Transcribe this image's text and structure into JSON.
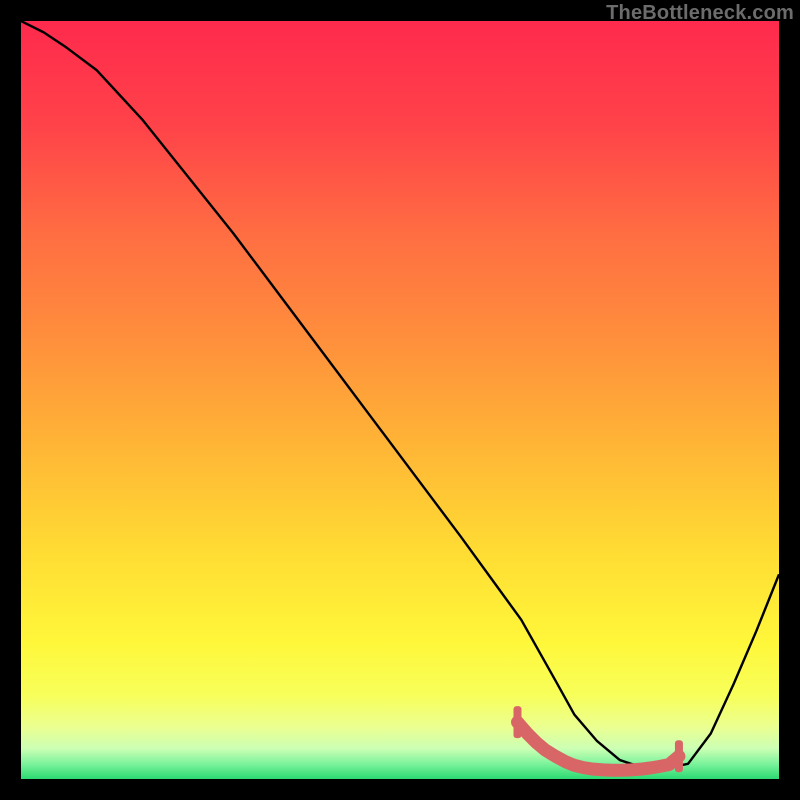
{
  "watermark": "TheBottleneck.com",
  "chart_data": {
    "type": "line",
    "title": "",
    "xlabel": "",
    "ylabel": "",
    "xlim": [
      0,
      100
    ],
    "ylim": [
      0,
      100
    ],
    "series": [
      {
        "name": "bottleneck-curve",
        "x": [
          0,
          3,
          6,
          10,
          16,
          22,
          28,
          34,
          40,
          46,
          52,
          58,
          62,
          66,
          70.5,
          73,
          76,
          79,
          82,
          85.5,
          88,
          91,
          94,
          97,
          100
        ],
        "y": [
          100,
          98.5,
          96.5,
          93.5,
          87,
          79.5,
          72,
          64,
          56,
          48,
          40,
          32,
          26.5,
          21,
          13,
          8.5,
          5,
          2.5,
          1.5,
          1.5,
          2,
          6,
          12.5,
          19.5,
          27
        ]
      },
      {
        "name": "optimal-flat-marker",
        "x": [
          65.5,
          66.8,
          68,
          69.2,
          70.5,
          71.8,
          73,
          74.2,
          75.5,
          76.8,
          78,
          79.2,
          80.5,
          81.8,
          83,
          84.2,
          85.5,
          86.8
        ],
        "y": [
          7.5,
          6,
          4.8,
          3.8,
          3,
          2.3,
          1.8,
          1.5,
          1.3,
          1.2,
          1.15,
          1.15,
          1.2,
          1.3,
          1.45,
          1.65,
          1.9,
          3
        ]
      }
    ],
    "gradient_stops": [
      {
        "offset": 0,
        "color": "#ff2a4d"
      },
      {
        "offset": 14,
        "color": "#ff4349"
      },
      {
        "offset": 28,
        "color": "#ff6d42"
      },
      {
        "offset": 42,
        "color": "#ff8f3c"
      },
      {
        "offset": 56,
        "color": "#ffb536"
      },
      {
        "offset": 70,
        "color": "#ffdc33"
      },
      {
        "offset": 82,
        "color": "#fff73a"
      },
      {
        "offset": 89,
        "color": "#f7ff5a"
      },
      {
        "offset": 93,
        "color": "#ecff8f"
      },
      {
        "offset": 96,
        "color": "#ccffb4"
      },
      {
        "offset": 98,
        "color": "#7cf39c"
      },
      {
        "offset": 100,
        "color": "#2bd972"
      }
    ],
    "marker_color": "#d96666",
    "curve_color": "#000000"
  }
}
